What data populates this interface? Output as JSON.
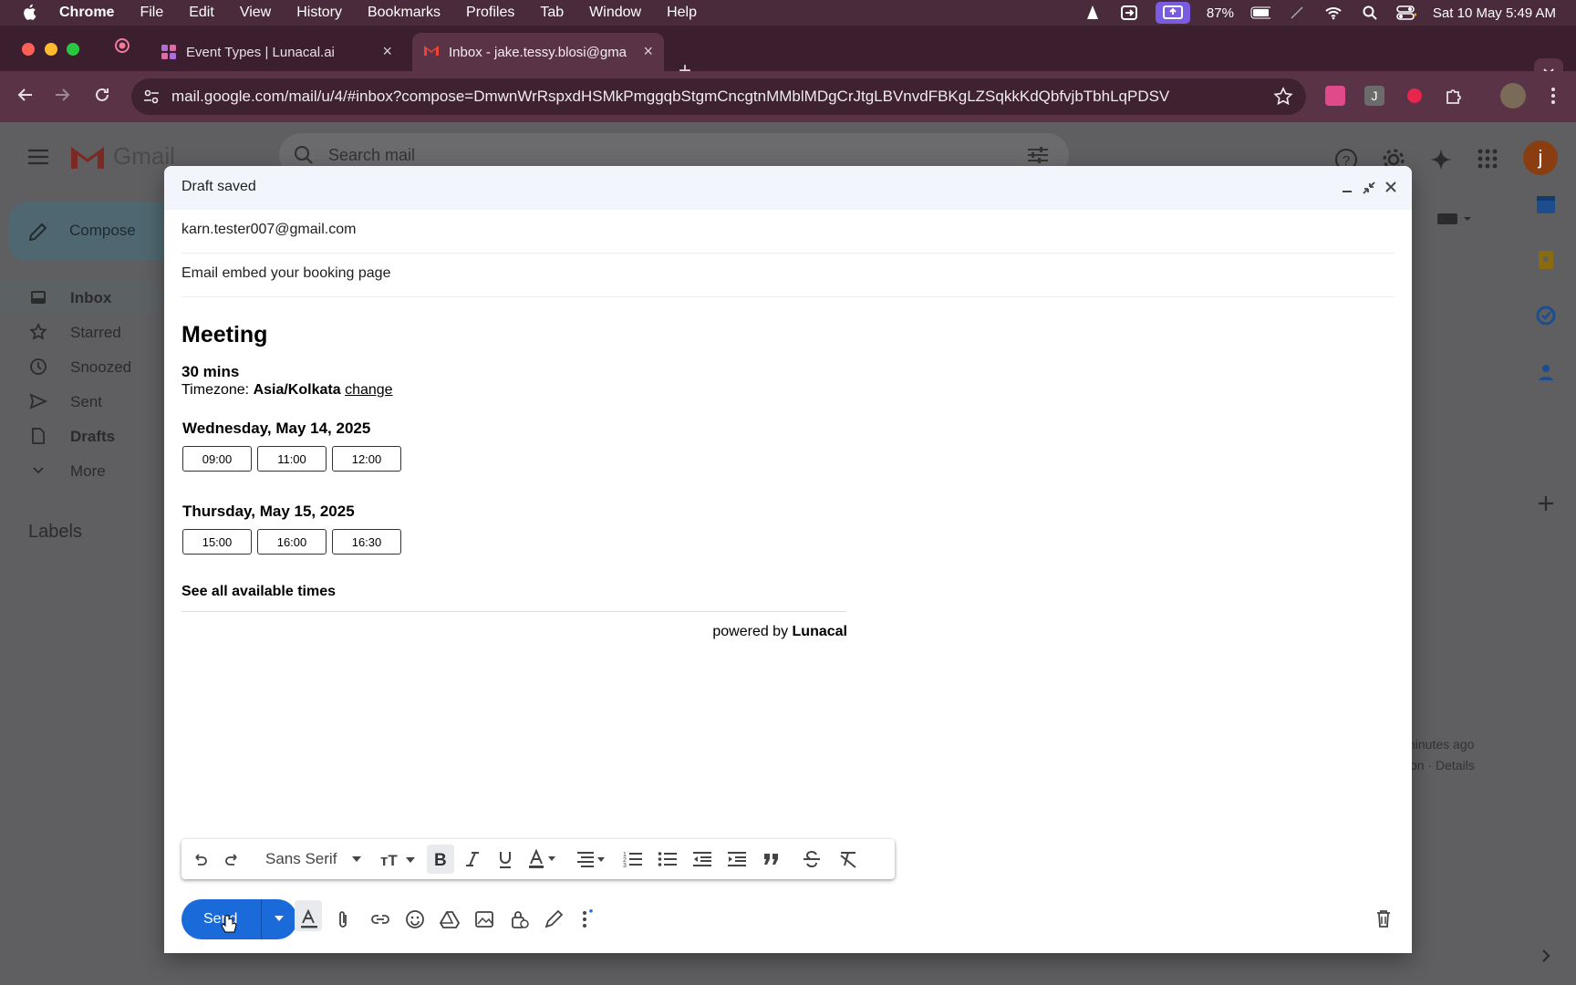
{
  "menubar": {
    "app": "Chrome",
    "items": [
      "File",
      "Edit",
      "View",
      "History",
      "Bookmarks",
      "Profiles",
      "Tab",
      "Window",
      "Help"
    ],
    "battery": "87%",
    "datetime": "Sat 10 May  5:49 AM"
  },
  "tabs": [
    {
      "title": "Event Types | Lunacal.ai",
      "icon": "lunacal-icon"
    },
    {
      "title": "Inbox - jake.tessy.blosi@gma",
      "icon": "gmail-icon"
    }
  ],
  "address_bar": {
    "url": "mail.google.com/mail/u/4/#inbox?compose=DmwnWrRspxdHSMkPmggqbStgmCncgtnMMblMDgCrJtgLBVnvdFBKgLZSqkkKdQbfvjbTbhLqPDSV"
  },
  "gmail": {
    "brand": "Gmail",
    "search_placeholder": "Search mail",
    "compose_label": "Compose",
    "avatar_letter": "j",
    "nav": [
      {
        "label": "Inbox",
        "icon": "inbox-icon"
      },
      {
        "label": "Starred",
        "icon": "star-icon"
      },
      {
        "label": "Snoozed",
        "icon": "clock-icon"
      },
      {
        "label": "Sent",
        "icon": "send-icon"
      },
      {
        "label": "Drafts",
        "icon": "draft-icon"
      },
      {
        "label": "More",
        "icon": "chevron-down-icon"
      }
    ],
    "labels_heading": "Labels",
    "bg_text_1": "ninutes ago",
    "bg_text_2": "on · Details"
  },
  "compose": {
    "title": "Draft saved",
    "to": "karn.tester007@gmail.com",
    "subject": "Email embed your booking page",
    "body": {
      "heading": "Meeting",
      "duration": "30 mins",
      "timezone_label": "Timezone:",
      "timezone_value": "Asia/Kolkata",
      "timezone_change": "change",
      "days": [
        {
          "date": "Wednesday, May 14, 2025",
          "slots": [
            "09:00",
            "11:00",
            "12:00"
          ]
        },
        {
          "date": "Thursday, May 15, 2025",
          "slots": [
            "15:00",
            "16:00",
            "16:30"
          ]
        }
      ],
      "see_all": "See all available times",
      "powered_by": "powered by",
      "powered_brand": "Lunacal"
    },
    "format_toolbar": {
      "font": "Sans Serif"
    },
    "send_label": "Send"
  }
}
